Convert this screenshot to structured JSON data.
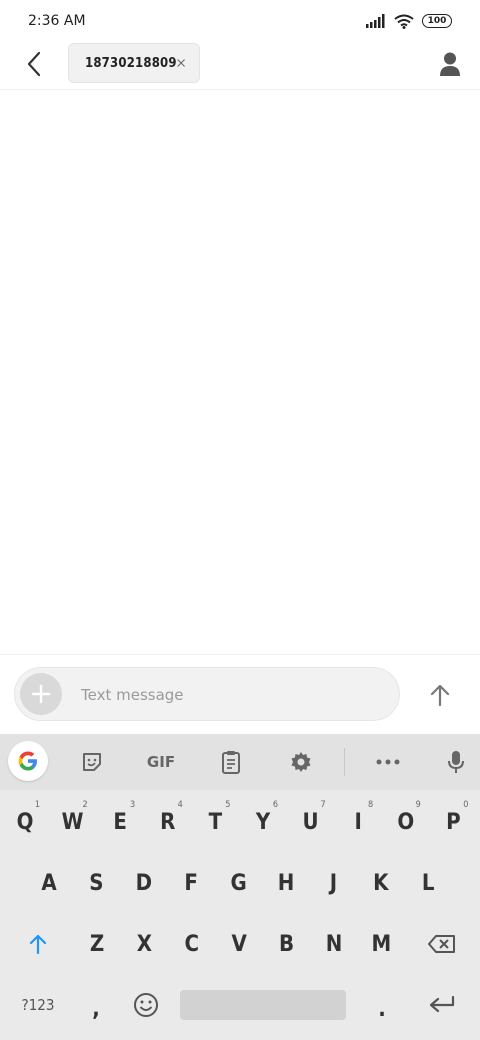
{
  "status_bar": {
    "time": "2:36 AM",
    "battery": "100"
  },
  "header": {
    "recipient": "18730218809"
  },
  "compose": {
    "placeholder": "Text message"
  },
  "keyboard": {
    "toolbar": {
      "gif_label": "GIF"
    },
    "row1": [
      {
        "key": "Q",
        "hint": "1"
      },
      {
        "key": "W",
        "hint": "2"
      },
      {
        "key": "E",
        "hint": "3"
      },
      {
        "key": "R",
        "hint": "4"
      },
      {
        "key": "T",
        "hint": "5"
      },
      {
        "key": "Y",
        "hint": "6"
      },
      {
        "key": "U",
        "hint": "7"
      },
      {
        "key": "I",
        "hint": "8"
      },
      {
        "key": "O",
        "hint": "9"
      },
      {
        "key": "P",
        "hint": "0"
      }
    ],
    "row2": [
      "A",
      "S",
      "D",
      "F",
      "G",
      "H",
      "J",
      "K",
      "L"
    ],
    "row3": [
      "Z",
      "X",
      "C",
      "V",
      "B",
      "N",
      "M"
    ],
    "bottom": {
      "symbols_label": "?123",
      "comma": ",",
      "period": "."
    }
  },
  "colors": {
    "accent": "#2196f3",
    "keyboard_bg": "#eaeaea",
    "toolbar_bg": "#e2e2e2"
  }
}
